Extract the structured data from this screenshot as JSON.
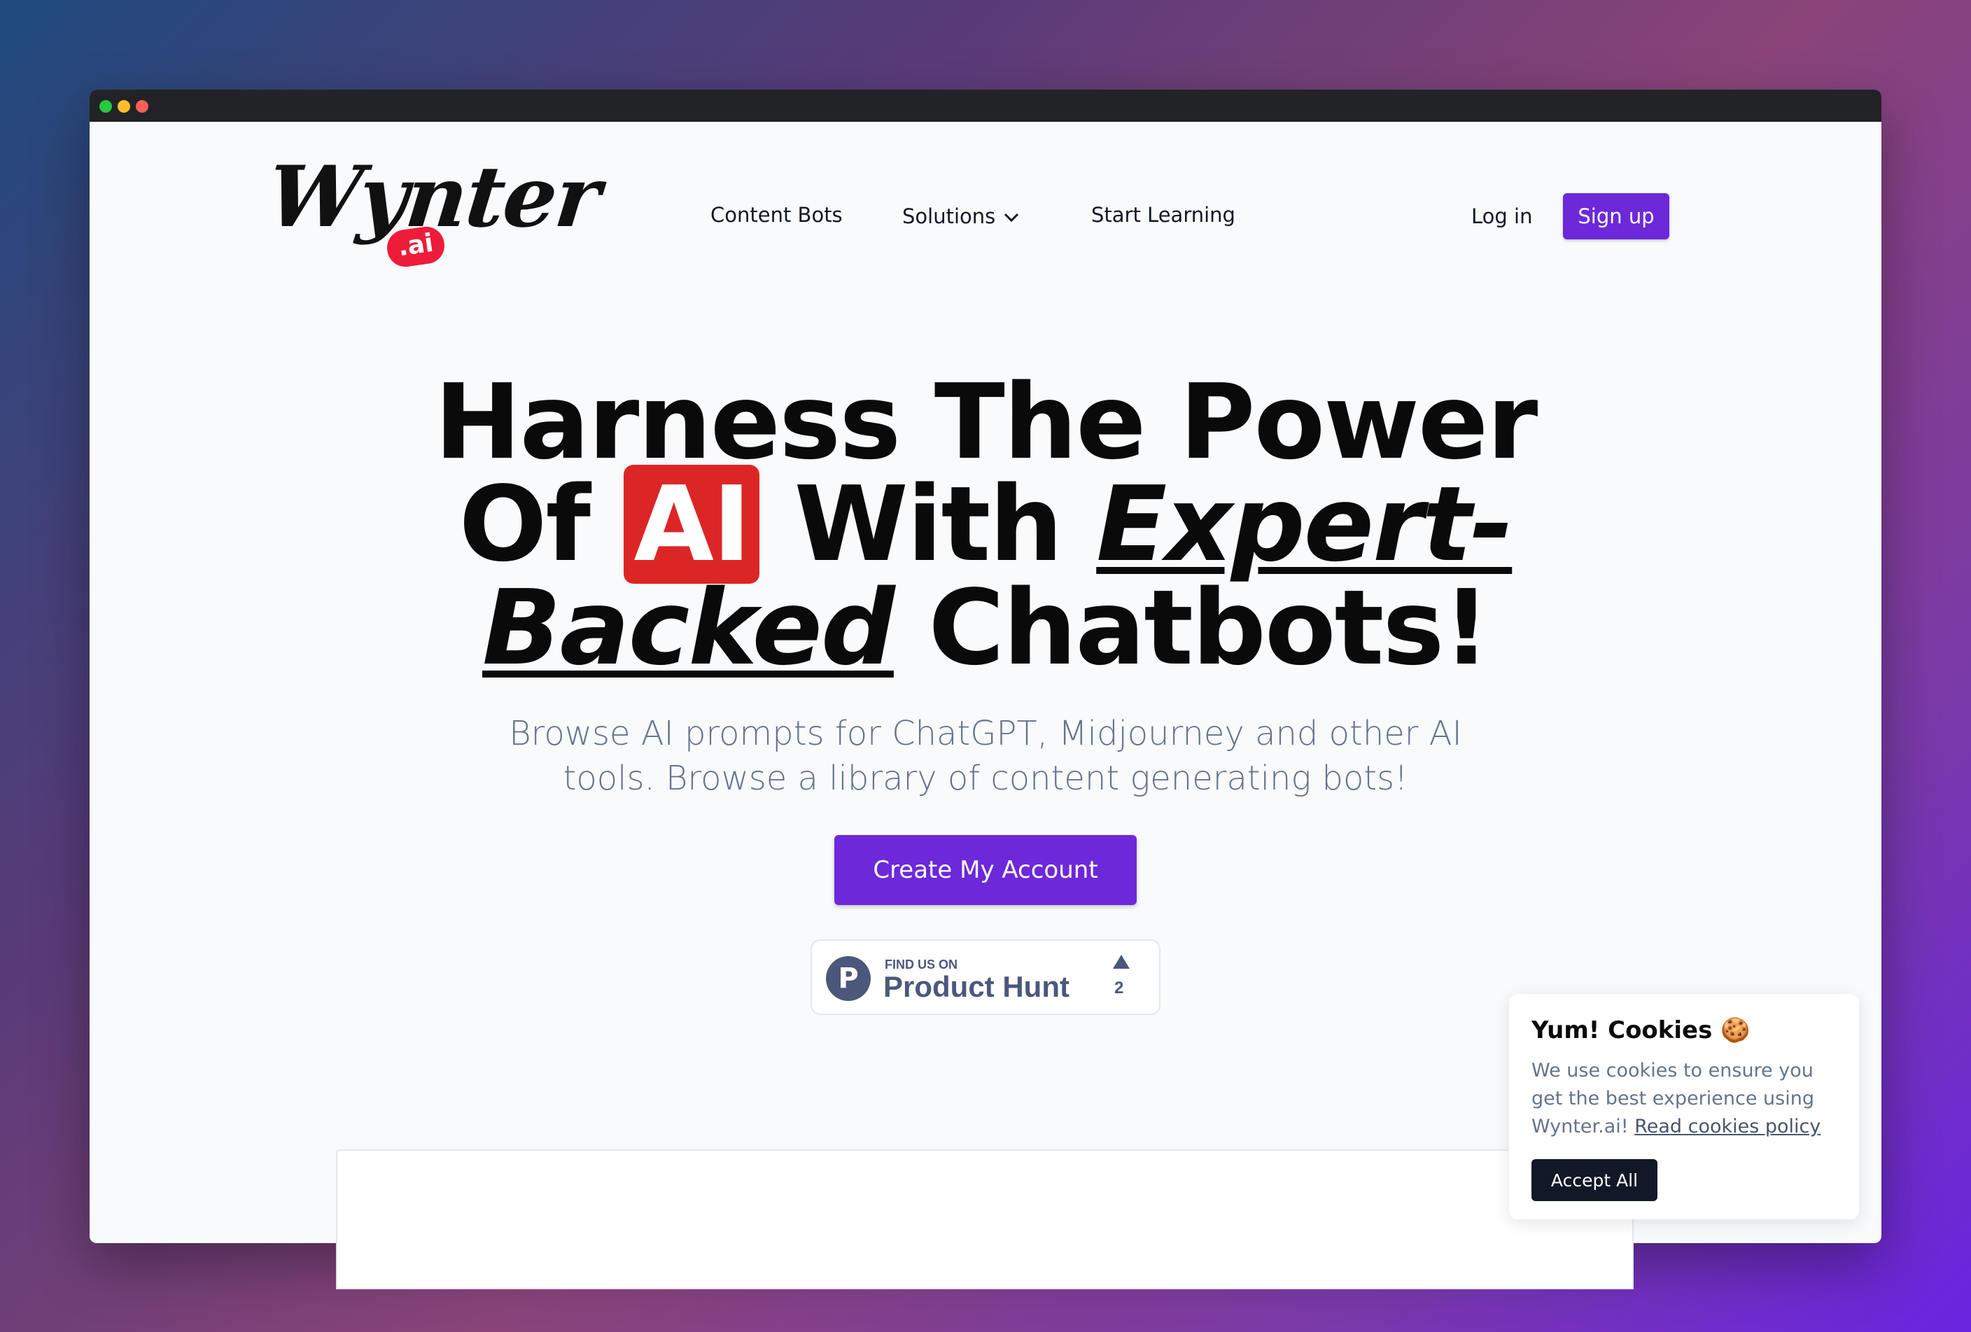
{
  "colors": {
    "accent": "#6d28d9",
    "ai_highlight": "#dc2626",
    "logo_badge": "#ee1c3a",
    "product_hunt": "#4b587c"
  },
  "logo": {
    "wordmark": "Wynter",
    "badge": ".ai"
  },
  "nav": {
    "links": [
      "Content Bots",
      "Solutions",
      "Start Learning"
    ],
    "solutions_icon": "chevron-down-icon",
    "login": "Log in",
    "signup": "Sign up"
  },
  "hero": {
    "title_line1": "Harness The Power",
    "title_of": "Of",
    "title_ai": "AI",
    "title_with": "With",
    "title_expert": "Expert-",
    "title_backed": "Backed",
    "title_chatbots": "Chatbots!",
    "subtitle": "Browse AI prompts for ChatGPT, Midjourney and other AI tools. Browse a library of content generating bots!",
    "cta": "Create My Account"
  },
  "product_hunt": {
    "small": "FIND US ON",
    "big": "Product Hunt",
    "logo_letter": "P",
    "upvotes": "2"
  },
  "cookie": {
    "title": "Yum! Cookies 🍪",
    "text": "We use cookies to ensure you get the best experience using Wynter.ai!",
    "link": "Read cookies policy",
    "accept": "Accept All"
  }
}
